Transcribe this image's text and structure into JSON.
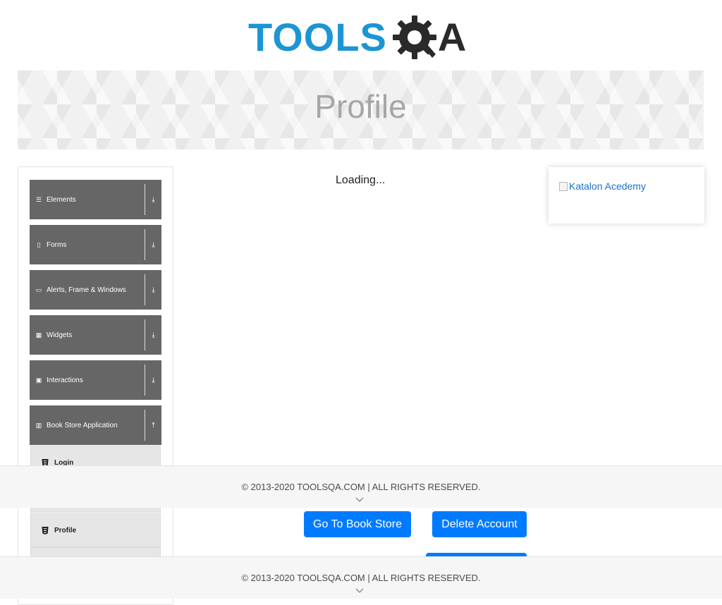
{
  "logo": {
    "tools_text": "TOOLS",
    "qa_text": "A",
    "alt": "TOOLSQA"
  },
  "banner": {
    "title": "Profile"
  },
  "sidebar": {
    "groups": [
      {
        "label": "Elements",
        "icon": "list-icon",
        "arrow": "⤓"
      },
      {
        "label": "Forms",
        "icon": "form-icon",
        "arrow": "⤓"
      },
      {
        "label": "Alerts, Frame & Windows",
        "icon": "window-icon",
        "arrow": "⤓"
      },
      {
        "label": "Widgets",
        "icon": "grid-icon",
        "arrow": "⤓"
      },
      {
        "label": "Interactions",
        "icon": "interaction-icon",
        "arrow": "⤓"
      },
      {
        "label": "Book Store Application",
        "icon": "books-icon",
        "arrow": "⤒"
      }
    ],
    "book_store_items": [
      {
        "label": "Login",
        "icon": "html5-icon"
      },
      {
        "label": "Profile",
        "icon": "html5-icon"
      }
    ]
  },
  "main": {
    "loading_text": "Loading...",
    "ad_alt": "Katalon Acedemy",
    "go_to_book_store": "Go To Book Store",
    "delete_account": "Delete Account"
  },
  "footer": {
    "copyright": "© 2013-2020 TOOLSQA.COM | ALL RIGHTS RESERVED."
  },
  "colors": {
    "accent": "#007bff",
    "sidebar_group": "#666666",
    "logo_blue": "#1b95d3",
    "banner_title": "#a6a6a6"
  }
}
